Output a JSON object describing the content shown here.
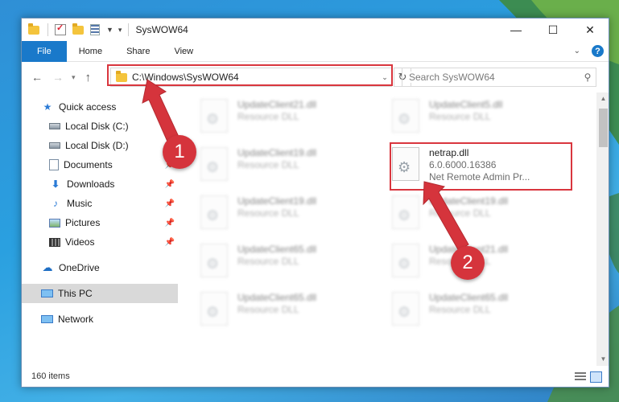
{
  "window": {
    "title": "SysWOW64",
    "controls": {
      "minimize": "—",
      "maximize": "☐",
      "close": "✕"
    }
  },
  "ribbon": {
    "tabs": [
      {
        "label": "File",
        "active": true
      },
      {
        "label": "Home"
      },
      {
        "label": "Share"
      },
      {
        "label": "View"
      }
    ],
    "help": "?"
  },
  "navigation": {
    "address": "C:\\Windows\\SysWOW64",
    "search_placeholder": "Search SysWOW64"
  },
  "sidebar": {
    "items": [
      {
        "label": "Quick access",
        "icon": "star-icon"
      },
      {
        "label": "Local Disk (C:)",
        "icon": "disk-icon"
      },
      {
        "label": "Local Disk (D:)",
        "icon": "disk-icon"
      },
      {
        "label": "Documents",
        "icon": "documents-icon",
        "pinned": true
      },
      {
        "label": "Downloads",
        "icon": "downloads-icon",
        "pinned": true
      },
      {
        "label": "Music",
        "icon": "music-icon",
        "pinned": true
      },
      {
        "label": "Pictures",
        "icon": "pictures-icon",
        "pinned": true
      },
      {
        "label": "Videos",
        "icon": "videos-icon",
        "pinned": true
      },
      {
        "label": "OneDrive",
        "icon": "onedrive-icon"
      },
      {
        "label": "This PC",
        "icon": "this-pc-icon",
        "selected": true
      },
      {
        "label": "Network",
        "icon": "network-icon"
      }
    ]
  },
  "files": {
    "left": [
      {
        "name": "UpdateClient21.dll",
        "type": "Resource DLL"
      },
      {
        "name": "UpdateClient19.dll",
        "type": "Resource DLL"
      },
      {
        "name": "UpdateClient19.dll",
        "type": "Resource DLL"
      },
      {
        "name": "UpdateClient65.dll",
        "type": "Resource DLL"
      },
      {
        "name": "UpdateClient65.dll",
        "type": "Resource DLL"
      }
    ],
    "right": [
      {
        "name": "UpdateClient5.dll",
        "type": "Resource DLL"
      },
      {
        "name": "netrap.dll",
        "version": "6.0.6000.16386",
        "description": "Net Remote Admin Pr...",
        "highlighted": true
      },
      {
        "name": "UpdateClient19.dll",
        "type": "Resource DLL"
      },
      {
        "name": "UpdateClient21.dll",
        "type": "Resource DLL"
      },
      {
        "name": "UpdateClient65.dll",
        "type": "Resource DLL"
      }
    ]
  },
  "status": {
    "item_count": "160 items"
  },
  "annotations": {
    "step1": "1",
    "step2": "2",
    "color": "#d5343c"
  }
}
